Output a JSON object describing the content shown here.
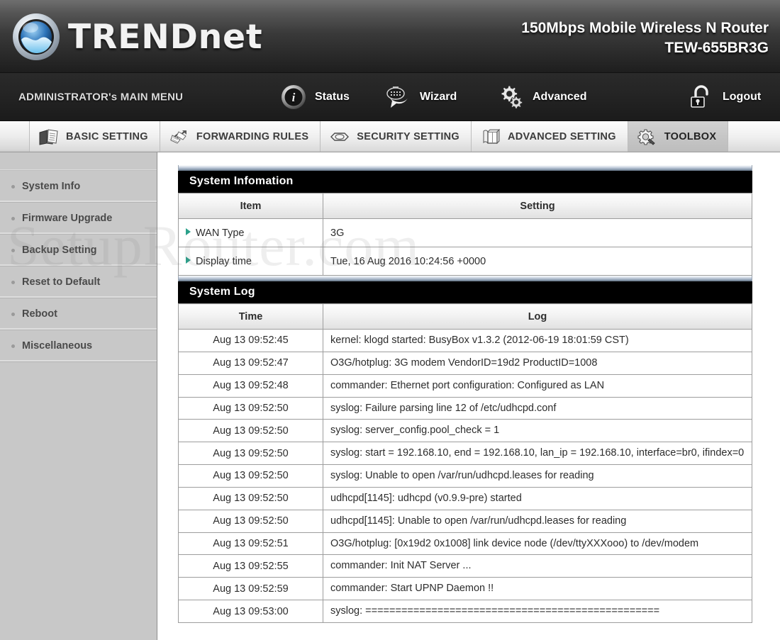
{
  "banner": {
    "logo_text_upper": "TRENDn",
    "logo_text_full": "TRENDnet",
    "logo_icon": "trendnet-globe-logo",
    "product_line1": "150Mbps Mobile Wireless N Router",
    "product_line2": "TEW-655BR3G"
  },
  "mainmenu": {
    "admin_label": "ADMINISTRATOR's MAIN MENU",
    "items": [
      {
        "label": "Status",
        "icon": "status-coin-icon"
      },
      {
        "label": "Wizard",
        "icon": "wizard-wand-icon"
      },
      {
        "label": "Advanced",
        "icon": "gears-icon"
      },
      {
        "label": "Logout",
        "icon": "open-padlock-icon"
      }
    ]
  },
  "tabs": [
    {
      "label": "BASIC SETTING",
      "icon": "folder-documents-icon",
      "active": false
    },
    {
      "label": "FORWARDING RULES",
      "icon": "forwarding-arrows-icon",
      "active": false
    },
    {
      "label": "SECURITY SETTING",
      "icon": "shield-nut-icon",
      "active": false
    },
    {
      "label": "ADVANCED SETTING",
      "icon": "book-icon",
      "active": false
    },
    {
      "label": "TOOLBOX",
      "icon": "gear-wrench-icon",
      "active": true
    }
  ],
  "sidebar": {
    "items": [
      {
        "label": "System Info"
      },
      {
        "label": "Firmware Upgrade"
      },
      {
        "label": "Backup Setting"
      },
      {
        "label": "Reset to Default"
      },
      {
        "label": "Reboot"
      },
      {
        "label": "Miscellaneous"
      }
    ]
  },
  "system_info": {
    "panel_title": "System Infomation",
    "headers": {
      "item": "Item",
      "setting": "Setting"
    },
    "rows": [
      {
        "item": "WAN Type",
        "setting": "3G"
      },
      {
        "item": "Display time",
        "setting": "Tue, 16 Aug 2016 10:24:56 +0000"
      }
    ]
  },
  "system_log": {
    "panel_title": "System Log",
    "headers": {
      "time": "Time",
      "log": "Log"
    },
    "rows": [
      {
        "time": "Aug 13 09:52:45",
        "log": "kernel: klogd started: BusyBox v1.3.2 (2012-06-19 18:01:59 CST)"
      },
      {
        "time": "Aug 13 09:52:47",
        "log": "O3G/hotplug: 3G modem VendorID=19d2 ProductID=1008"
      },
      {
        "time": "Aug 13 09:52:48",
        "log": "commander: Ethernet port configuration: Configured as LAN"
      },
      {
        "time": "Aug 13 09:52:50",
        "log": "syslog: Failure parsing line 12 of /etc/udhcpd.conf"
      },
      {
        "time": "Aug 13 09:52:50",
        "log": "syslog: server_config.pool_check = 1"
      },
      {
        "time": "Aug 13 09:52:50",
        "log": "syslog: start = 192.168.10, end = 192.168.10, lan_ip = 192.168.10, interface=br0, ifindex=0"
      },
      {
        "time": "Aug 13 09:52:50",
        "log": "syslog: Unable to open /var/run/udhcpd.leases for reading"
      },
      {
        "time": "Aug 13 09:52:50",
        "log": "udhcpd[1145]: udhcpd (v0.9.9-pre) started"
      },
      {
        "time": "Aug 13 09:52:50",
        "log": "udhcpd[1145]: Unable to open /var/run/udhcpd.leases for reading"
      },
      {
        "time": "Aug 13 09:52:51",
        "log": "O3G/hotplug: [0x19d2 0x1008] link device node (/dev/ttyXXXooo) to /dev/modem"
      },
      {
        "time": "Aug 13 09:52:55",
        "log": "commander: Init NAT Server ..."
      },
      {
        "time": "Aug 13 09:52:59",
        "log": "commander: Start UPNP Daemon !!"
      },
      {
        "time": "Aug 13 09:53:00",
        "log": "syslog: ================================================="
      }
    ]
  },
  "watermark": {
    "text": "SetupRouter.com"
  },
  "colors": {
    "panel_header_bg": "#000000",
    "accent_arrow": "#2aa08a",
    "sidebar_bg": "#c8c8c8",
    "tab_active_bg": "#c6c6c6"
  }
}
